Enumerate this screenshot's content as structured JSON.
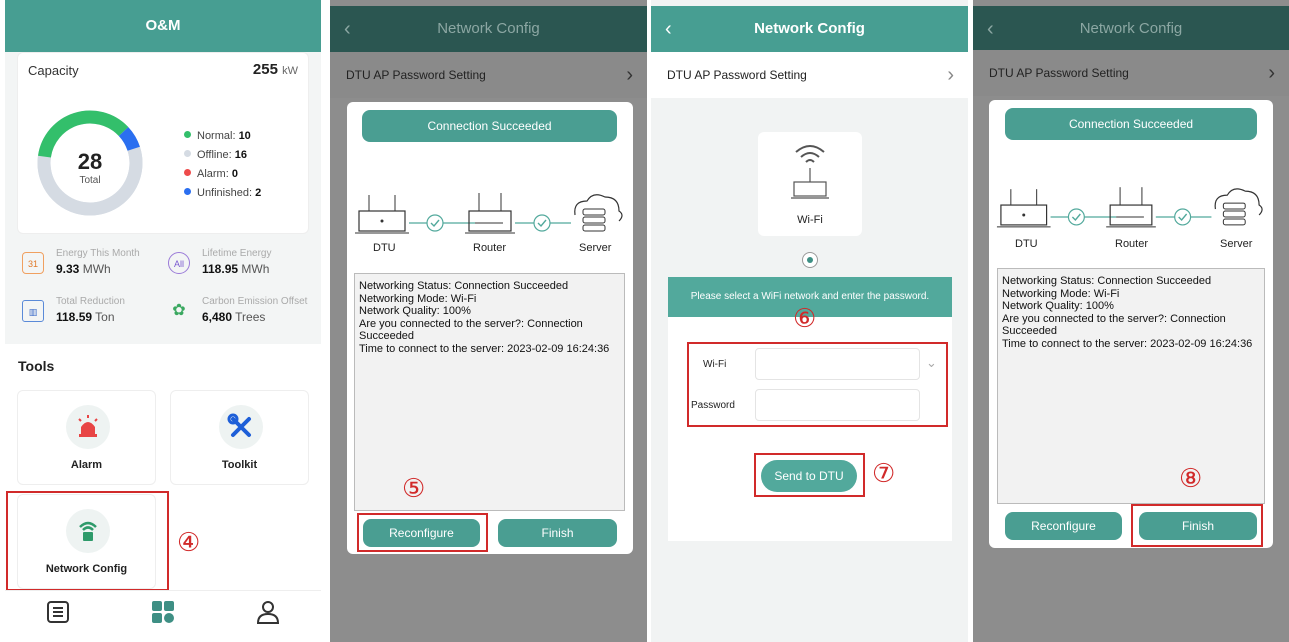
{
  "panel1": {
    "title": "O&M",
    "capacity": {
      "label": "Capacity",
      "value": "255",
      "unit": "kW"
    },
    "donut": {
      "total": "28",
      "total_label": "Total",
      "segments": {
        "normal": 10,
        "offline": 16,
        "alarm": 0,
        "unfinished": 2
      }
    },
    "legend": [
      {
        "label": "Normal: ",
        "value": "10",
        "color": "#33bf6b"
      },
      {
        "label": "Offline: ",
        "value": "16",
        "color": "#d5dbe3"
      },
      {
        "label": "Alarm: ",
        "value": "0",
        "color": "#ee4b4b"
      },
      {
        "label": "Unfinished: ",
        "value": "2",
        "color": "#2b6ff0"
      }
    ],
    "stats": [
      {
        "title": "Energy This Month",
        "value": "9.33",
        "unit": " MWh",
        "icon": "calendar-icon",
        "icon_text": "31"
      },
      {
        "title": "Lifetime Energy",
        "value": "118.95",
        "unit": " MWh",
        "icon": "all-icon",
        "icon_text": "All"
      },
      {
        "title": "Total Reduction",
        "value": "118.59",
        "unit": " Ton",
        "icon": "factory-icon",
        "icon_text": "▥"
      },
      {
        "title": "Carbon Emission Offset",
        "value": "6,480",
        "unit": " Trees",
        "icon": "tree-icon",
        "icon_text": "✿"
      }
    ],
    "tools_heading": "Tools",
    "tools": {
      "alarm": "Alarm",
      "toolkit": "Toolkit",
      "network_config": "Network Config"
    },
    "step": "④"
  },
  "config_title": "Network Config",
  "ap_setting": "DTU AP Password Setting",
  "connection_status": "Connection Succeeded",
  "diagram_labels": {
    "dtu": "DTU",
    "router": "Router",
    "server": "Server"
  },
  "log_lines": [
    "Networking Status: Connection Succeeded",
    "Networking Mode: Wi-Fi",
    "Network Quality: 100%",
    "Are you connected to the server?: Connection Succeeded",
    "Time to connect to the server: 2023-02-09 16:24:36"
  ],
  "buttons": {
    "reconfigure": "Reconfigure",
    "finish": "Finish",
    "send": "Send to DTU"
  },
  "panel2": {
    "step": "⑤"
  },
  "panel3": {
    "wifi_label": "Wi-Fi",
    "instruction": "Please select a WiFi network and enter the password.",
    "wifi_field_label": "Wi-Fi",
    "password_label": "Password",
    "step_fields": "⑥",
    "step_send": "⑦"
  },
  "panel4": {
    "step": "⑧"
  },
  "colors": {
    "teal": "#52a99c",
    "header_dim": "#2b5651",
    "highlight": "#d12a2a"
  }
}
